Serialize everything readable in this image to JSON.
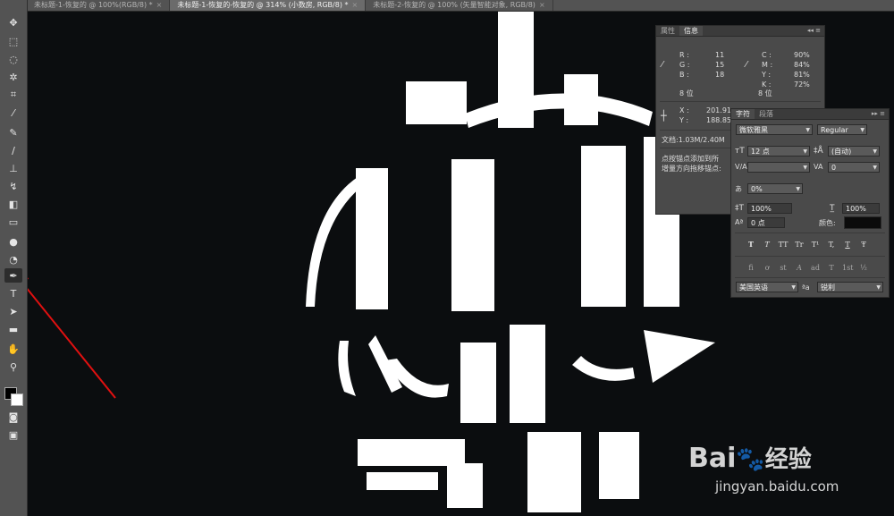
{
  "tabs": [
    {
      "label": "未标题-1-恢复的 @ 100%(RGB/8) *",
      "active": false
    },
    {
      "label": "未标题-1-恢复的-恢复的 @ 314% (小数房, RGB/8) *",
      "active": true
    },
    {
      "label": "未标题-2-恢复的 @ 100% (矢量智能对象, RGB/8)",
      "active": false
    }
  ],
  "tab_close": "×",
  "tools": [
    "move",
    "marquee",
    "lasso",
    "magic-wand",
    "crop",
    "eyedropper",
    "healing",
    "brush",
    "stamp",
    "history-brush",
    "eraser",
    "gradient",
    "blur",
    "dodge",
    "pen",
    "type",
    "path-selection",
    "rectangle",
    "hand",
    "zoom"
  ],
  "info_panel": {
    "tabs": [
      "属性",
      "信息"
    ],
    "rgb": {
      "R": "11",
      "G": "15",
      "B": "18"
    },
    "cmyk": {
      "C": "90%",
      "M": "84%",
      "Y": "81%",
      "K": "72%"
    },
    "bits_left": "8 位",
    "bits_right": "8 位",
    "x": "201.91",
    "y": "188.85",
    "doc": "文档:1.03M/2.40M",
    "hint1": "点按锚点添加到所",
    "hint2": "增量方向拖移锚点:"
  },
  "char_panel": {
    "tabs": [
      "字符",
      "段落"
    ],
    "font_family": "微软雅黑",
    "font_style": "Regular",
    "font_size": "12 点",
    "leading": "(自动)",
    "kerning": "",
    "tracking": "0",
    "scale_pct": "0%",
    "vscale": "100%",
    "hscale": "100%",
    "baseline": "0 点",
    "color_label": "颜色:",
    "type_buttons": [
      "T",
      "T",
      "TT",
      "Tr",
      "T¹",
      "T,",
      "T",
      "Ŧ"
    ],
    "ot_buttons": [
      "fi",
      "ơ",
      "st",
      "A",
      "ad",
      "T",
      "1st",
      "½"
    ],
    "language": "美国英语",
    "aa_label": "ªa",
    "antialias": "锐利"
  },
  "watermark": {
    "brand": "Bai",
    "brand2": "经验",
    "url": "jingyan.baidu.com"
  },
  "colors": {
    "toolbar": "#535353",
    "panel": "#4a4a4a",
    "canvas": "#0b0d0f",
    "arrow": "#e01010"
  }
}
